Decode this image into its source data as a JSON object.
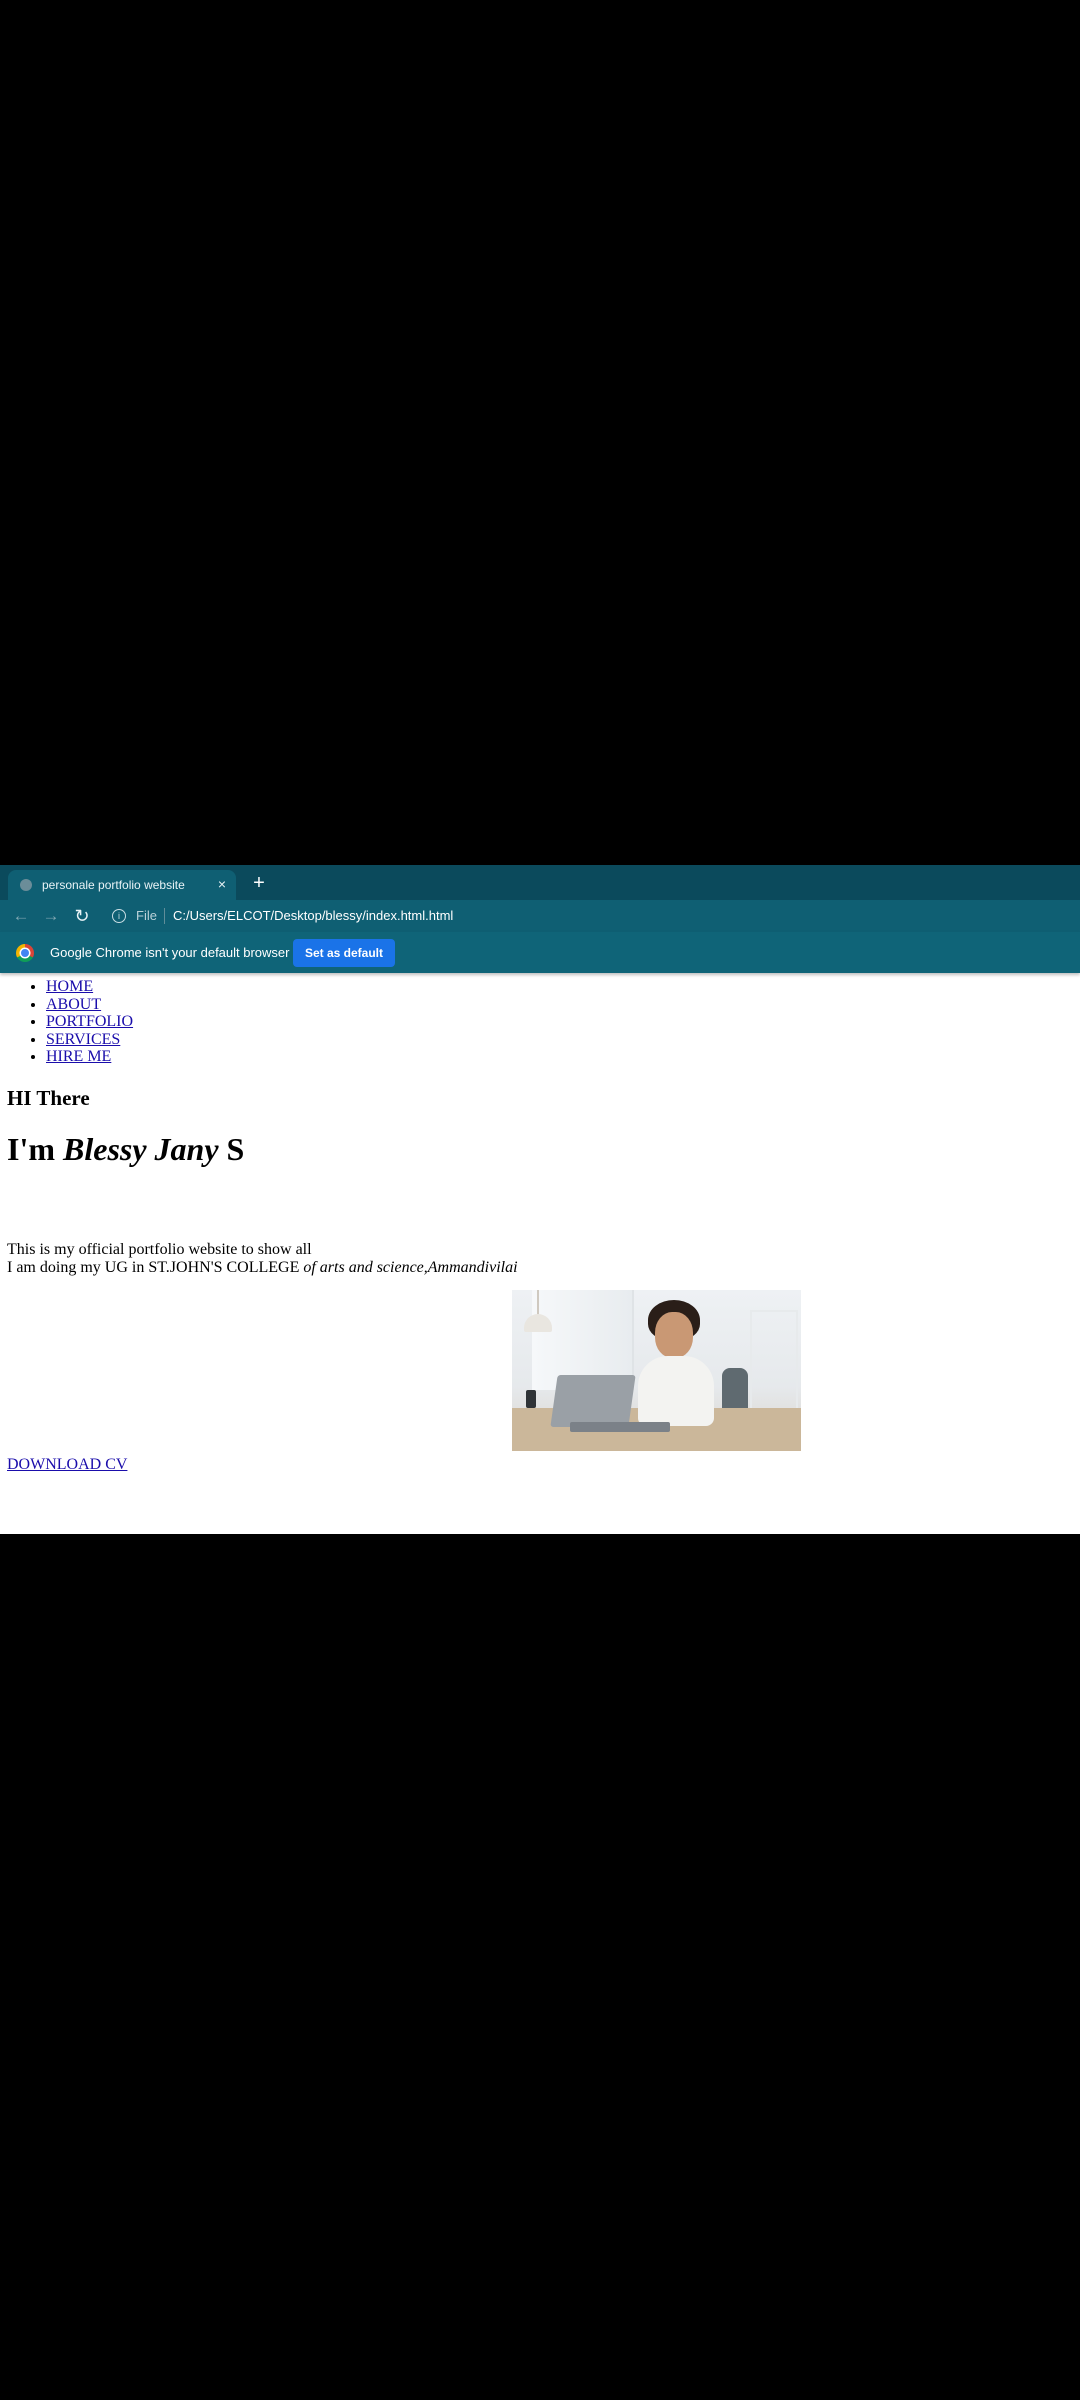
{
  "browser": {
    "tab": {
      "title": "personale portfolio website",
      "close": "×"
    },
    "new_tab": "+",
    "toolbar": {
      "back": "←",
      "forward": "→",
      "reload": "↻",
      "scheme": "File",
      "info": "i",
      "url": "C:/Users/ELCOT/Desktop/blessy/index.html.html"
    },
    "infobar": {
      "message": "Google Chrome isn't your default browser",
      "button": "Set as default"
    }
  },
  "page": {
    "nav": [
      "HOME",
      "ABOUT",
      "PORTFOLIO",
      "SERVICES",
      "HIRE ME"
    ],
    "greeting": "HI There",
    "intro": {
      "prefix": "I'm ",
      "name": "Blessy Jany",
      "suffix": " S"
    },
    "para_line1": "This is my official portfolio website to show all",
    "para_line2_prefix": "I am doing my UG in ST.JOHN'S COLLEGE ",
    "para_line2_italic": "of arts and science,Ammandivilai",
    "download": "DOWNLOAD CV"
  }
}
